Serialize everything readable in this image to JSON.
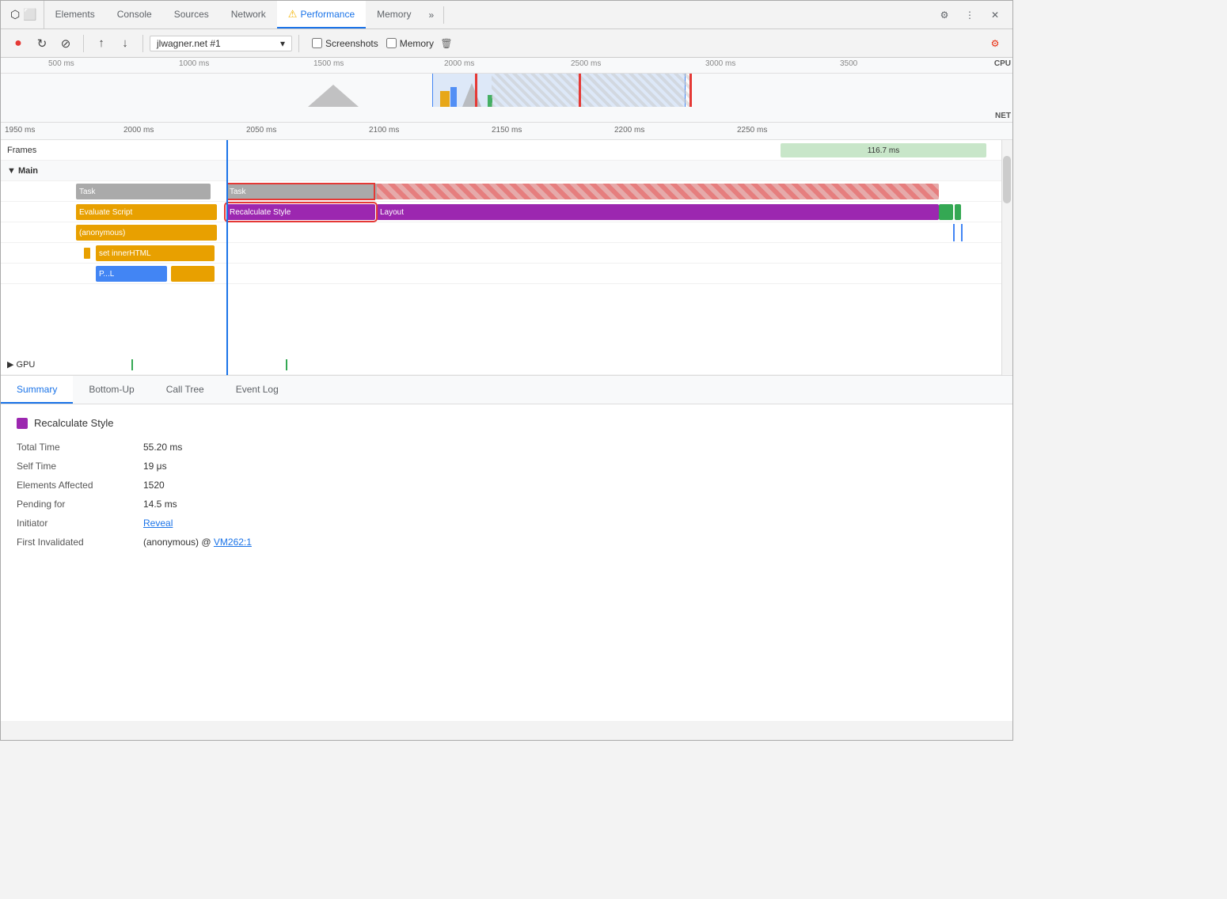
{
  "tabs": {
    "items": [
      {
        "label": "Elements",
        "active": false
      },
      {
        "label": "Console",
        "active": false
      },
      {
        "label": "Sources",
        "active": false
      },
      {
        "label": "Network",
        "active": false
      },
      {
        "label": "Performance",
        "active": true,
        "warning": true
      },
      {
        "label": "Memory",
        "active": false
      }
    ],
    "more_label": "»"
  },
  "toolbar": {
    "record_label": "●",
    "reload_label": "↻",
    "clear_label": "⊘",
    "upload_label": "↑",
    "download_label": "↓",
    "profile_placeholder": "jlwagner.net #1",
    "screenshots_label": "Screenshots",
    "memory_label": "Memory"
  },
  "overview": {
    "ruler_ticks": [
      "500 ms",
      "1000 ms",
      "1500 ms",
      "2000 ms",
      "2500 ms",
      "3000 ms",
      "3500"
    ],
    "cpu_label": "CPU",
    "net_label": "NET"
  },
  "detail": {
    "ruler_ticks": [
      "1950 ms",
      "2000 ms",
      "2050 ms",
      "2100 ms",
      "2150 ms",
      "2200 ms",
      "2250 ms"
    ],
    "rows": {
      "frames_label": "Frames",
      "frames_value": "116.7 ms",
      "main_label": "▼ Main",
      "gpu_label": "▶ GPU"
    },
    "bars": {
      "task1": {
        "label": "Task",
        "color": "gray"
      },
      "task2": {
        "label": "Task",
        "color": "gray"
      },
      "task2_hatch": {
        "label": "",
        "color": "task-hatch"
      },
      "evaluate_script": {
        "label": "Evaluate Script",
        "color": "yellow"
      },
      "recalculate_style": {
        "label": "Recalculate Style",
        "color": "purple"
      },
      "layout": {
        "label": "Layout",
        "color": "purple"
      },
      "anonymous": {
        "label": "(anonymous)",
        "color": "yellow"
      },
      "set_inner_html": {
        "label": "set innerHTML",
        "color": "yellow"
      },
      "pl": {
        "label": "P...L",
        "color": "blue"
      },
      "yellow_small": {
        "label": "",
        "color": "yellow"
      }
    }
  },
  "bottom_tabs": {
    "items": [
      {
        "label": "Summary",
        "active": true
      },
      {
        "label": "Bottom-Up",
        "active": false
      },
      {
        "label": "Call Tree",
        "active": false
      },
      {
        "label": "Event Log",
        "active": false
      }
    ]
  },
  "summary": {
    "title": "Recalculate Style",
    "color": "#9c27b0",
    "rows": [
      {
        "label": "Total Time",
        "value": "55.20 ms"
      },
      {
        "label": "Self Time",
        "value": "19 μs"
      },
      {
        "label": "Elements Affected",
        "value": "1520"
      },
      {
        "label": "Pending for",
        "value": "14.5 ms"
      },
      {
        "label": "Initiator",
        "value": "Reveal",
        "link": true
      }
    ],
    "first_invalidated_label": "First Invalidated",
    "first_invalidated_anon": "(anonymous) @",
    "first_invalidated_link": "VM262:1"
  }
}
